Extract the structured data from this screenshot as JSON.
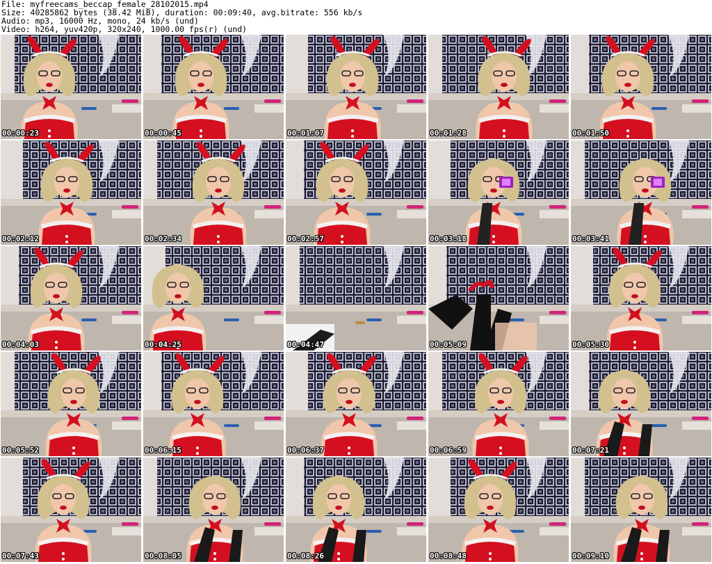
{
  "header": {
    "file_line": "File: myfreecams_beccap_female_28102015.mp4",
    "size_line": "Size: 40285862 bytes (38.42 MiB), duration: 00:09:40, avg.bitrate: 556 kb/s",
    "audio_line": "Audio: mp3, 16000 Hz, mono, 24 kb/s (und)",
    "video_line": "Video: h264, yuv420p, 320x240, 1000.00 fps(r) (und)"
  },
  "thumbnails": [
    {
      "timestamp": "00:00:23",
      "scene": "portrait"
    },
    {
      "timestamp": "00:00:45",
      "scene": "portrait"
    },
    {
      "timestamp": "00:01:07",
      "scene": "portrait"
    },
    {
      "timestamp": "00:01:28",
      "scene": "portrait"
    },
    {
      "timestamp": "00:01:50",
      "scene": "portrait"
    },
    {
      "timestamp": "00:02:12",
      "scene": "portrait"
    },
    {
      "timestamp": "00:02:34",
      "scene": "portrait"
    },
    {
      "timestamp": "00:02:57",
      "scene": "portrait"
    },
    {
      "timestamp": "00:03:18",
      "scene": "camera"
    },
    {
      "timestamp": "00:03:41",
      "scene": "camera"
    },
    {
      "timestamp": "00:04:03",
      "scene": "portrait"
    },
    {
      "timestamp": "00:04:25",
      "scene": "leaning"
    },
    {
      "timestamp": "00:04:47",
      "scene": "empty"
    },
    {
      "timestamp": "00:05:09",
      "scene": "legs"
    },
    {
      "timestamp": "00:05:30",
      "scene": "portrait"
    },
    {
      "timestamp": "00:05:52",
      "scene": "portrait"
    },
    {
      "timestamp": "00:06:15",
      "scene": "portrait"
    },
    {
      "timestamp": "00:06:37",
      "scene": "portrait"
    },
    {
      "timestamp": "00:06:59",
      "scene": "portrait"
    },
    {
      "timestamp": "00:07:21",
      "scene": "gloves"
    },
    {
      "timestamp": "00:07:43",
      "scene": "portrait"
    },
    {
      "timestamp": "00:08:05",
      "scene": "gloves"
    },
    {
      "timestamp": "00:08:26",
      "scene": "gloves"
    },
    {
      "timestamp": "00:08:48",
      "scene": "portrait"
    },
    {
      "timestamp": "00:09:10",
      "scene": "gloves"
    }
  ],
  "colors": {
    "wallpaper_dark": "#1c1c30",
    "wallpaper_light": "#d8d8e8",
    "wall": "#cfcac4",
    "couch": "#bfb6ad",
    "costume_red": "#d41020",
    "hair": "#d2c08e",
    "skin": "#f0c7ab",
    "fur": "#f4f0f0"
  }
}
